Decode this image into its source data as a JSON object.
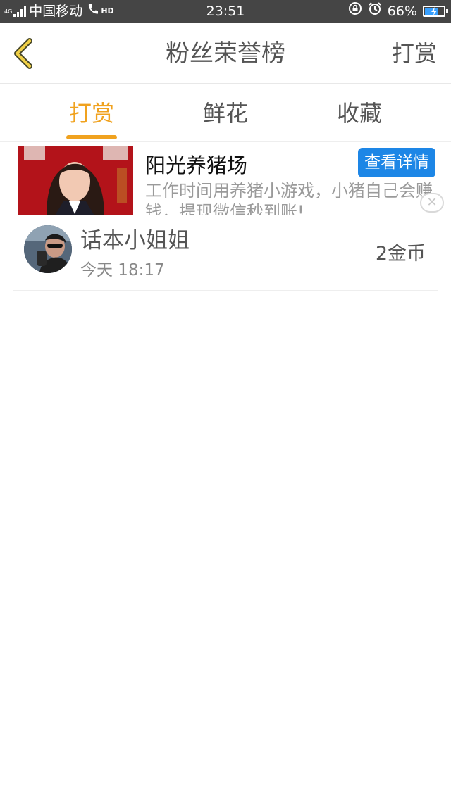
{
  "status_bar": {
    "network": "4G",
    "carrier": "中国移动",
    "hd": "HD",
    "time": "23:51",
    "battery": "66%"
  },
  "nav": {
    "title": "粉丝荣誉榜",
    "action": "打赏"
  },
  "tabs": [
    {
      "label": "打赏",
      "active": true
    },
    {
      "label": "鲜花",
      "active": false
    },
    {
      "label": "收藏",
      "active": false
    }
  ],
  "ad": {
    "title": "阳光养猪场",
    "cta": "查看详情",
    "desc": "工作时间用养猪小游戏，小猪自己会赚钱，提现微信秒到账!"
  },
  "rewards": [
    {
      "name": "话本小姐姐",
      "time": "今天 18:17",
      "amount": "2金币"
    }
  ],
  "colors": {
    "accent": "#f0a21f",
    "cta": "#1d86e6",
    "status_bar": "#454545"
  }
}
